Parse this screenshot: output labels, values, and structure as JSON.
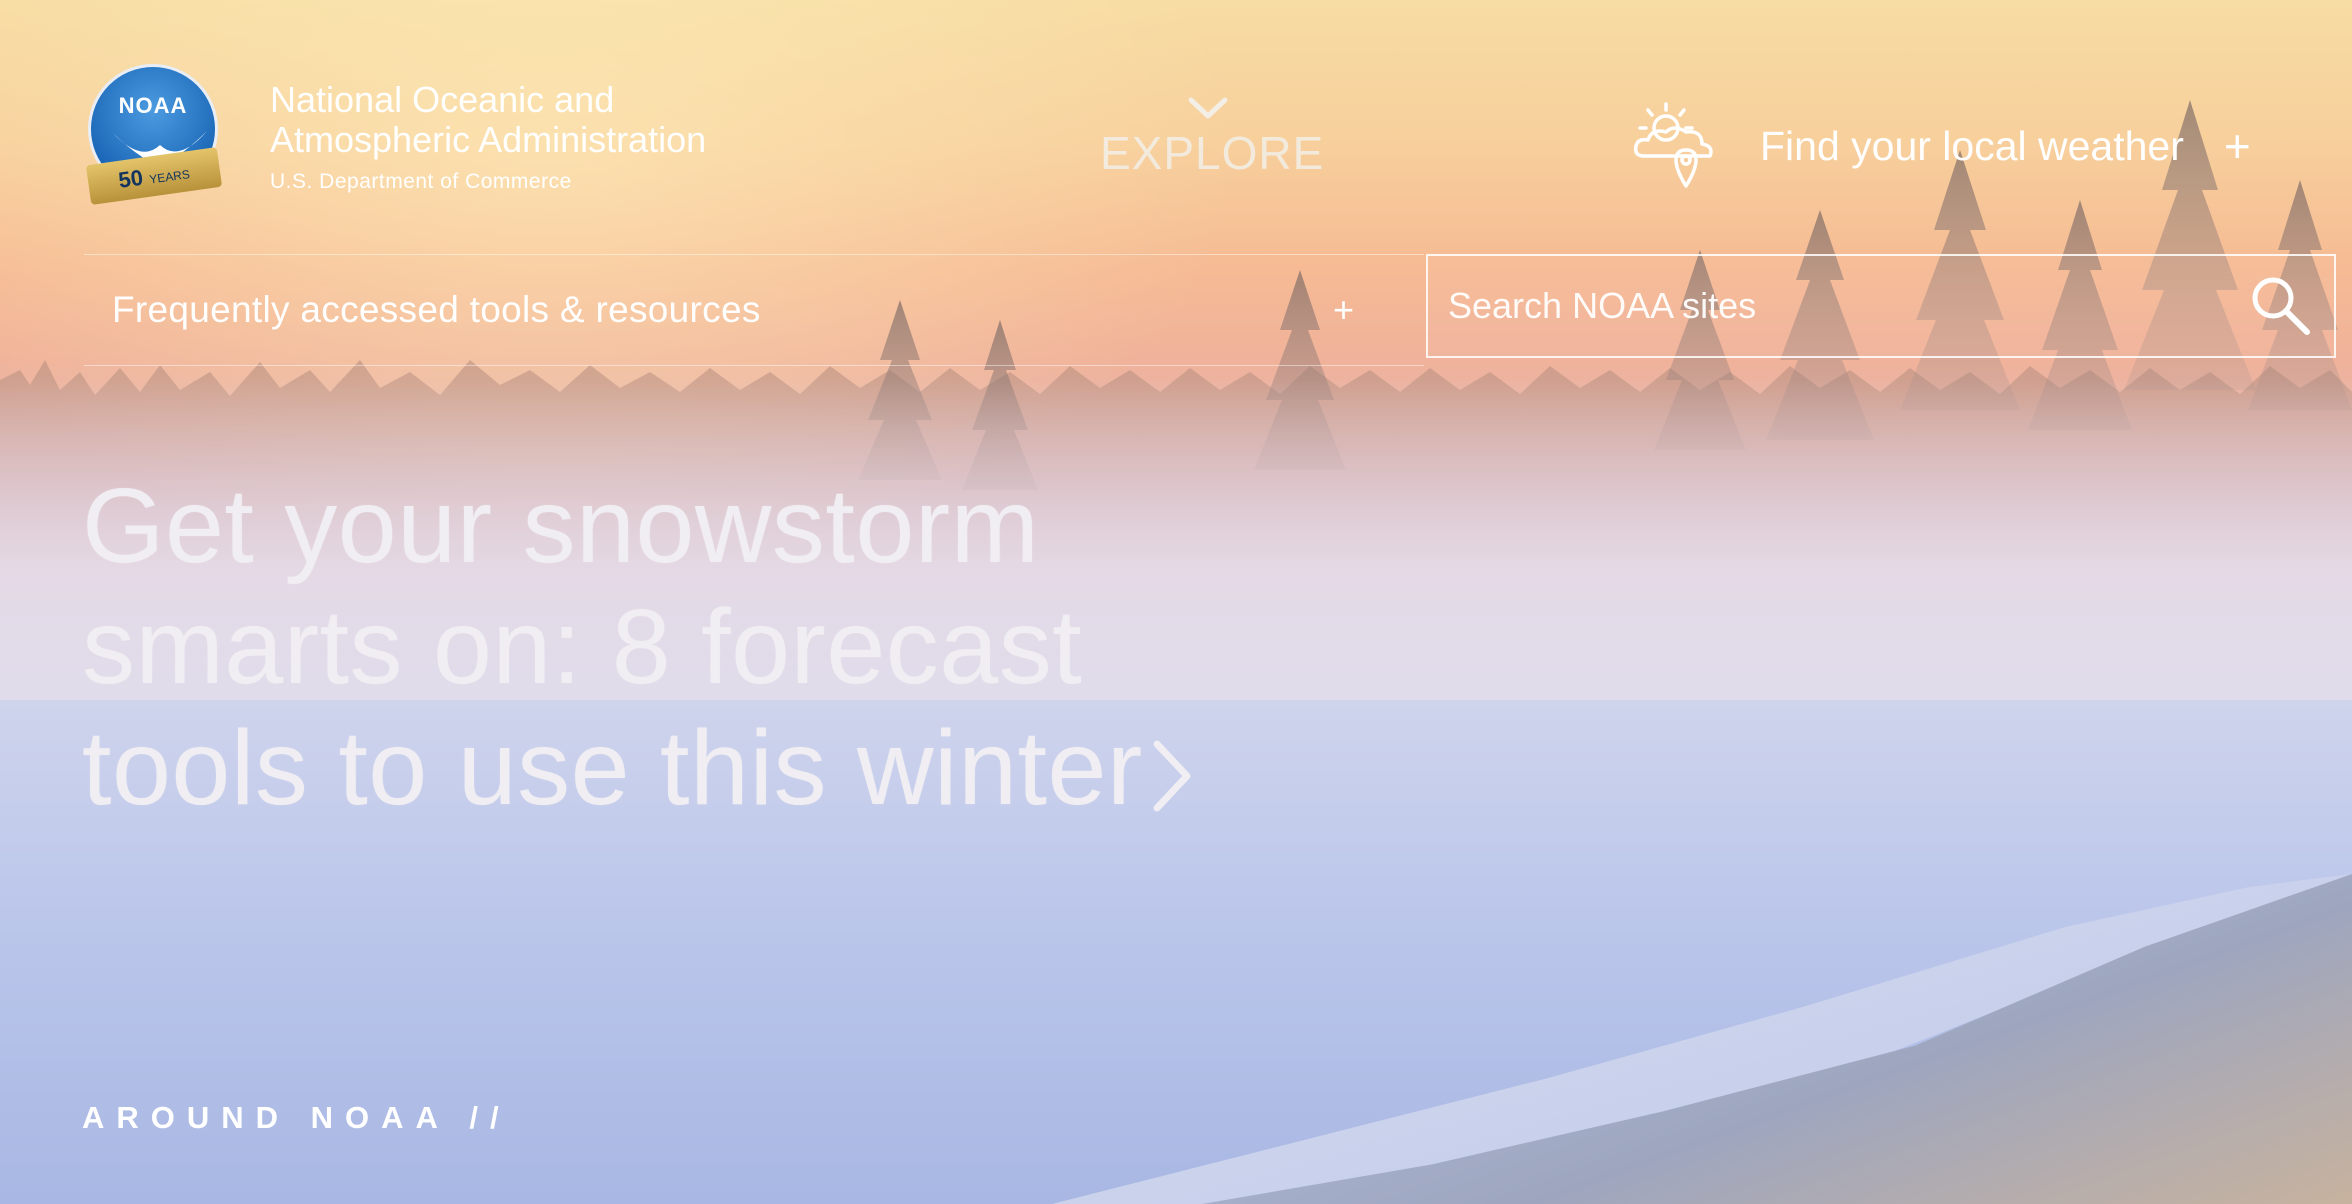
{
  "header": {
    "logo": {
      "name": "noaa-50-years-logo",
      "text": "NOAA",
      "ribbon_number": "50",
      "ribbon_word": "YEARS"
    },
    "agency_line1": "National Oceanic and",
    "agency_line2": "Atmospheric Administration",
    "department": "U.S. Department of Commerce",
    "explore_label": "EXPLORE",
    "weather": {
      "icon": "weather-location-icon",
      "label": "Find your local weather",
      "expand": "+"
    }
  },
  "tools": {
    "label": "Frequently accessed tools & resources",
    "expand": "+"
  },
  "search": {
    "placeholder": "Search NOAA sites",
    "icon": "search-icon"
  },
  "hero": {
    "line1": "Get your snowstorm",
    "line2": "smarts on: 8 forecast",
    "line3": "tools to use this winter",
    "icon": "chevron-right-icon"
  },
  "section": {
    "label": "AROUND NOAA //"
  },
  "colors": {
    "text": "#ffffff",
    "logo_blue": "#1c68b8",
    "logo_gold": "#d2b05a"
  }
}
